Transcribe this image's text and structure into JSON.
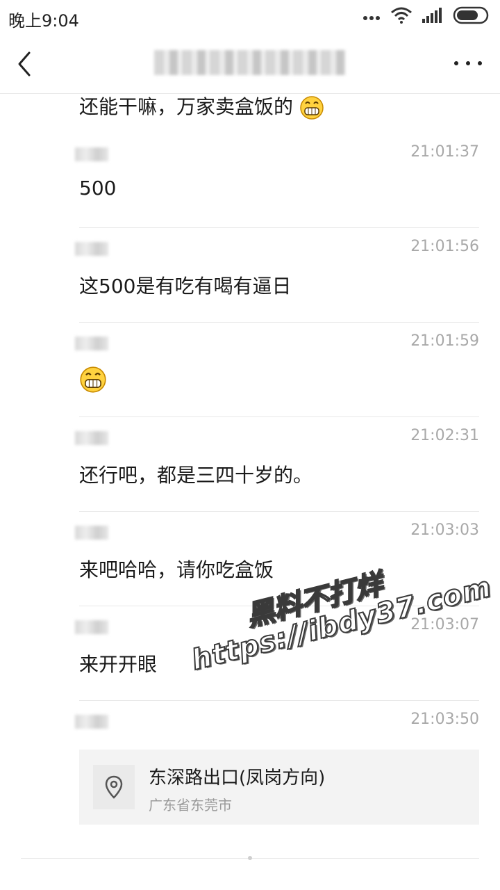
{
  "status_bar": {
    "time": "晚上9:04",
    "icons": [
      "more-dots-icon",
      "wifi-icon",
      "signal-icon",
      "battery-icon"
    ]
  },
  "header": {
    "back_icon": "back-chevron-icon",
    "more_icon": "more-icon"
  },
  "partial_message": {
    "text": "还能干嘛，万家卖盒饭的"
  },
  "messages": [
    {
      "time": "21:01:37",
      "text": "500"
    },
    {
      "time": "21:01:56",
      "text": "这500是有吃有喝有逼日"
    },
    {
      "time": "21:01:59",
      "text": ""
    },
    {
      "time": "21:02:31",
      "text": "还行吧，都是三四十岁的。"
    },
    {
      "time": "21:03:03",
      "text": "来吧哈哈，请你吃盒饭"
    },
    {
      "time": "21:03:07",
      "text": "来开开眼"
    },
    {
      "time": "21:03:50",
      "text": ""
    }
  ],
  "location": {
    "title": "东深路出口(凤岗方向)",
    "subtitle": "广东省东莞市",
    "icon": "location-pin-icon"
  },
  "watermark": {
    "line1": "黑料不打烊",
    "line2": "https://ibdy37.com"
  },
  "colors": {
    "timestamp": "#a8a8a8",
    "divider": "#e8e8e8",
    "card_bg": "#f3f3f3",
    "emoji_yellow": "#ffd23f"
  }
}
